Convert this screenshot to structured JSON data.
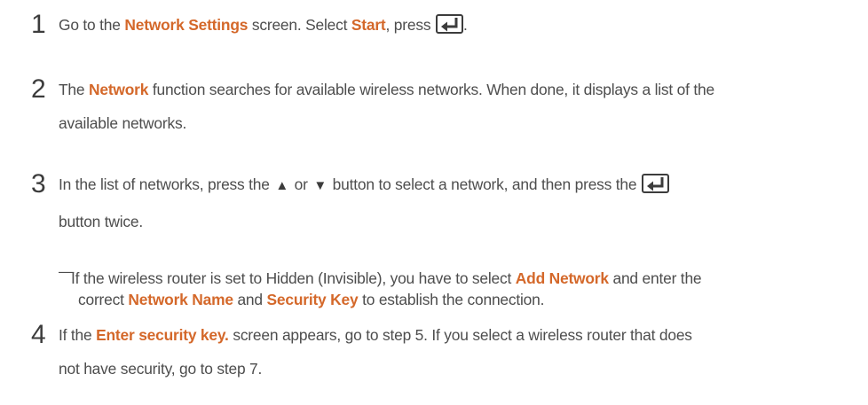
{
  "steps": [
    {
      "number": "1",
      "parts": [
        "Go to the ",
        "Network Settings",
        " screen. Select ",
        "Start",
        ", press ",
        "."
      ]
    },
    {
      "number": "2",
      "line1": [
        "The ",
        "Network",
        " function searches for available wireless networks. When done, it displays a list of the"
      ],
      "line2": "available networks."
    },
    {
      "number": "3",
      "line1": [
        "In the list of networks, press the ",
        "▲",
        " or ",
        "▼",
        " button to select a network, and then press the "
      ],
      "line2": "button twice."
    },
    {
      "number": "4",
      "line1": [
        "If the ",
        "Enter security key.",
        " screen appears, go to step 5. If you select a wireless router that does"
      ],
      "line2": "not have security, go to step 7."
    }
  ],
  "note": {
    "dash": "—",
    "line1": [
      "If the wireless router is set to Hidden (Invisible), you have to select ",
      "Add Network",
      " and enter the"
    ],
    "line2": [
      "correct ",
      "Network Name",
      " and ",
      "Security Key",
      " to establish the connection."
    ]
  },
  "icons": [
    "enter-key-icon",
    "up-triangle-icon",
    "down-triangle-icon"
  ],
  "colors": {
    "highlight": "#d4682a",
    "text": "#4d4d4d"
  }
}
